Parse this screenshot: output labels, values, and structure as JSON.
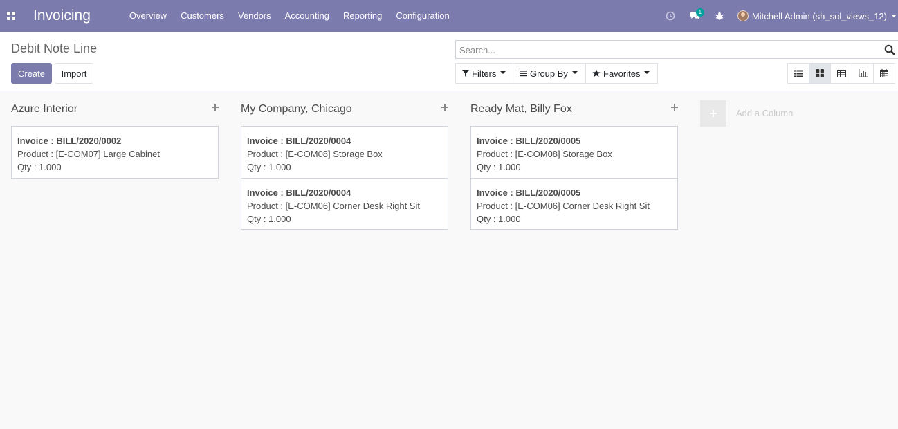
{
  "navbar": {
    "app_title": "Invoicing",
    "menu": [
      "Overview",
      "Customers",
      "Vendors",
      "Accounting",
      "Reporting",
      "Configuration"
    ],
    "messages_badge": "1",
    "user": "Mitchell Admin (sh_sol_views_12)"
  },
  "control_panel": {
    "breadcrumb": "Debit Note Line",
    "create_label": "Create",
    "import_label": "Import",
    "search_placeholder": "Search...",
    "filters_label": "Filters",
    "groupby_label": "Group By",
    "favorites_label": "Favorites"
  },
  "kanban": {
    "columns": [
      {
        "title": "Azure Interior",
        "cards": [
          {
            "invoice_label": "Invoice : BILL/2020/0002",
            "product": "Product : [E-COM07] Large Cabinet",
            "qty": "Qty : 1.000"
          }
        ]
      },
      {
        "title": "My Company, Chicago",
        "cards": [
          {
            "invoice_label": "Invoice : BILL/2020/0004",
            "product": "Product : [E-COM08] Storage Box",
            "qty": "Qty : 1.000"
          },
          {
            "invoice_label": "Invoice : BILL/2020/0004",
            "product": "Product : [E-COM06] Corner Desk Right Sit",
            "qty": "Qty : 1.000"
          }
        ]
      },
      {
        "title": "Ready Mat, Billy Fox",
        "cards": [
          {
            "invoice_label": "Invoice : BILL/2020/0005",
            "product": "Product : [E-COM08] Storage Box",
            "qty": "Qty : 1.000"
          },
          {
            "invoice_label": "Invoice : BILL/2020/0005",
            "product": "Product : [E-COM06] Corner Desk Right Sit",
            "qty": "Qty : 1.000"
          }
        ]
      }
    ],
    "add_column_label": "Add a Column"
  },
  "colors": {
    "brand": "#7c7bad",
    "badge": "#00a09d"
  }
}
